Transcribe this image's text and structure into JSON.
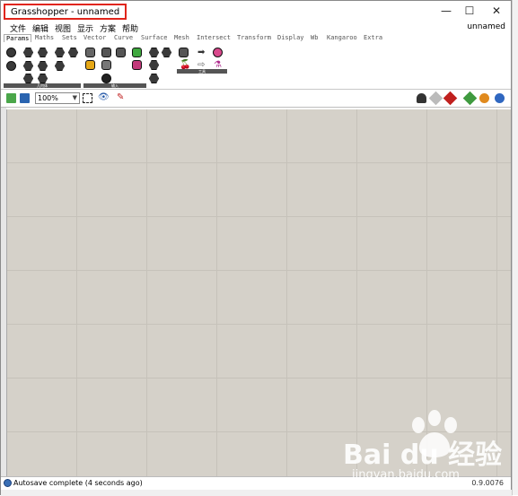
{
  "window": {
    "title": "Grasshopper - unnamed",
    "doc_name": "unnamed"
  },
  "controls": {
    "minimize": "—",
    "maximize": "☐",
    "close": "✕"
  },
  "menu": [
    "文件",
    "编辑",
    "视图",
    "显示",
    "方案",
    "帮助"
  ],
  "tabs": [
    "Params",
    "Maths",
    "Sets",
    "Vector",
    "Curve",
    "Surface",
    "Mesh",
    "Intersect",
    "Transform",
    "Display",
    "Wb",
    "Kangaroo",
    "Extra"
  ],
  "ribbon_groups": [
    "几何体",
    "输入",
    "工具"
  ],
  "toolbar": {
    "zoom": "100%"
  },
  "status": {
    "text": "Autosave complete (4 seconds ago)",
    "version": "0.9.0076"
  },
  "colors": {
    "highlight": "#e0251b",
    "canvas": "#d5d1c9",
    "grid": "#c6c2ba"
  },
  "watermark": {
    "brand": "Bai du 经验",
    "url": "jingyan.baidu.com"
  }
}
